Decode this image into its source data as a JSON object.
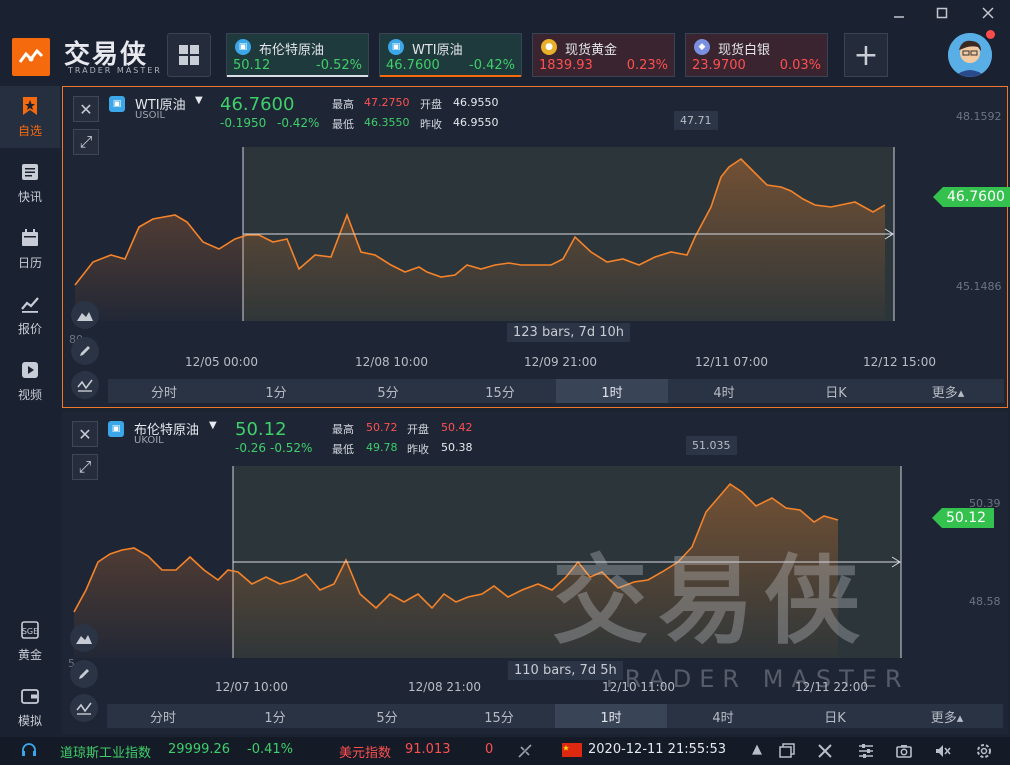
{
  "app": {
    "logo_text": "交易侠",
    "logo_sub": "TRADER MASTER",
    "watermark_text": "交易侠",
    "watermark_sub": "TRADER MASTER"
  },
  "quotes": [
    {
      "name": "布伦特原油",
      "price": "50.12",
      "pct": "-0.52%",
      "dir": "down",
      "icon": "oil-icon"
    },
    {
      "name": "WTI原油",
      "price": "46.7600",
      "pct": "-0.42%",
      "dir": "down",
      "icon": "oil-icon"
    },
    {
      "name": "现货黄金",
      "price": "1839.93",
      "pct": "0.23%",
      "dir": "up",
      "icon": "gold-icon"
    },
    {
      "name": "现货白银",
      "price": "23.9700",
      "pct": "0.03%",
      "dir": "up",
      "icon": "silver-icon"
    }
  ],
  "sidebar": {
    "items": [
      {
        "label": "自选",
        "icon": "star-bookmark-icon",
        "active": true
      },
      {
        "label": "快讯",
        "icon": "news-icon"
      },
      {
        "label": "日历",
        "icon": "calendar-icon"
      },
      {
        "label": "报价",
        "icon": "chart-line-icon"
      },
      {
        "label": "视频",
        "icon": "play-icon"
      },
      {
        "label": "黄金",
        "icon": "gold-bar-icon"
      },
      {
        "label": "模拟",
        "icon": "wallet-icon"
      }
    ]
  },
  "panel1": {
    "name": "WTI原油",
    "code": "USOIL",
    "price": "46.7600",
    "chg": "-0.1950",
    "pct": "-0.42%",
    "high_label": "最高",
    "high": "47.2750",
    "open_label": "开盘",
    "open": "46.9550",
    "low_label": "最低",
    "low": "46.3550",
    "prev_label": "昨收",
    "prev": "46.9550",
    "axis_top": "48.1592",
    "axis_mid": "45.1486",
    "axis_left": "80",
    "price_tag": "46.7600",
    "hi_tag": "47.71",
    "bars": "123 bars, 7d 10h",
    "dates": [
      "12/05 00:00",
      "12/08 10:00",
      "12/09 21:00",
      "12/11 07:00",
      "12/12 15:00"
    ]
  },
  "panel2": {
    "name": "布伦特原油",
    "code": "UKOIL",
    "price": "50.12",
    "chg": "-0.26",
    "pct": "-0.52%",
    "high_label": "最高",
    "high": "50.72",
    "open_label": "开盘",
    "open": "50.42",
    "low_label": "最低",
    "low": "49.78",
    "prev_label": "昨收",
    "prev": "50.38",
    "axis_top": "50.39",
    "axis_mid": "48.58",
    "axis_left": "5",
    "price_tag": "50.12",
    "hi_tag": "51.035",
    "bars": "110 bars, 7d 5h",
    "dates": [
      "12/07 10:00",
      "12/08 21:00",
      "12/10 11:00",
      "12/11 22:00"
    ]
  },
  "timeframes": [
    "分时",
    "1分",
    "5分",
    "15分",
    "1时",
    "4时",
    "日K",
    "更多▴"
  ],
  "status": {
    "idx1_name": "道琼斯工业指数",
    "idx1_val": "29999.26",
    "idx1_pct": "-0.41%",
    "idx2_name": "美元指数",
    "idx2_val": "91.013",
    "idx2_chg": "0",
    "datetime": "2020-12-11  21:55:53"
  },
  "colors": {
    "accent": "#f46a0c",
    "up": "#ff5050",
    "down": "#3fcf6a",
    "line": "#f5832a"
  }
}
